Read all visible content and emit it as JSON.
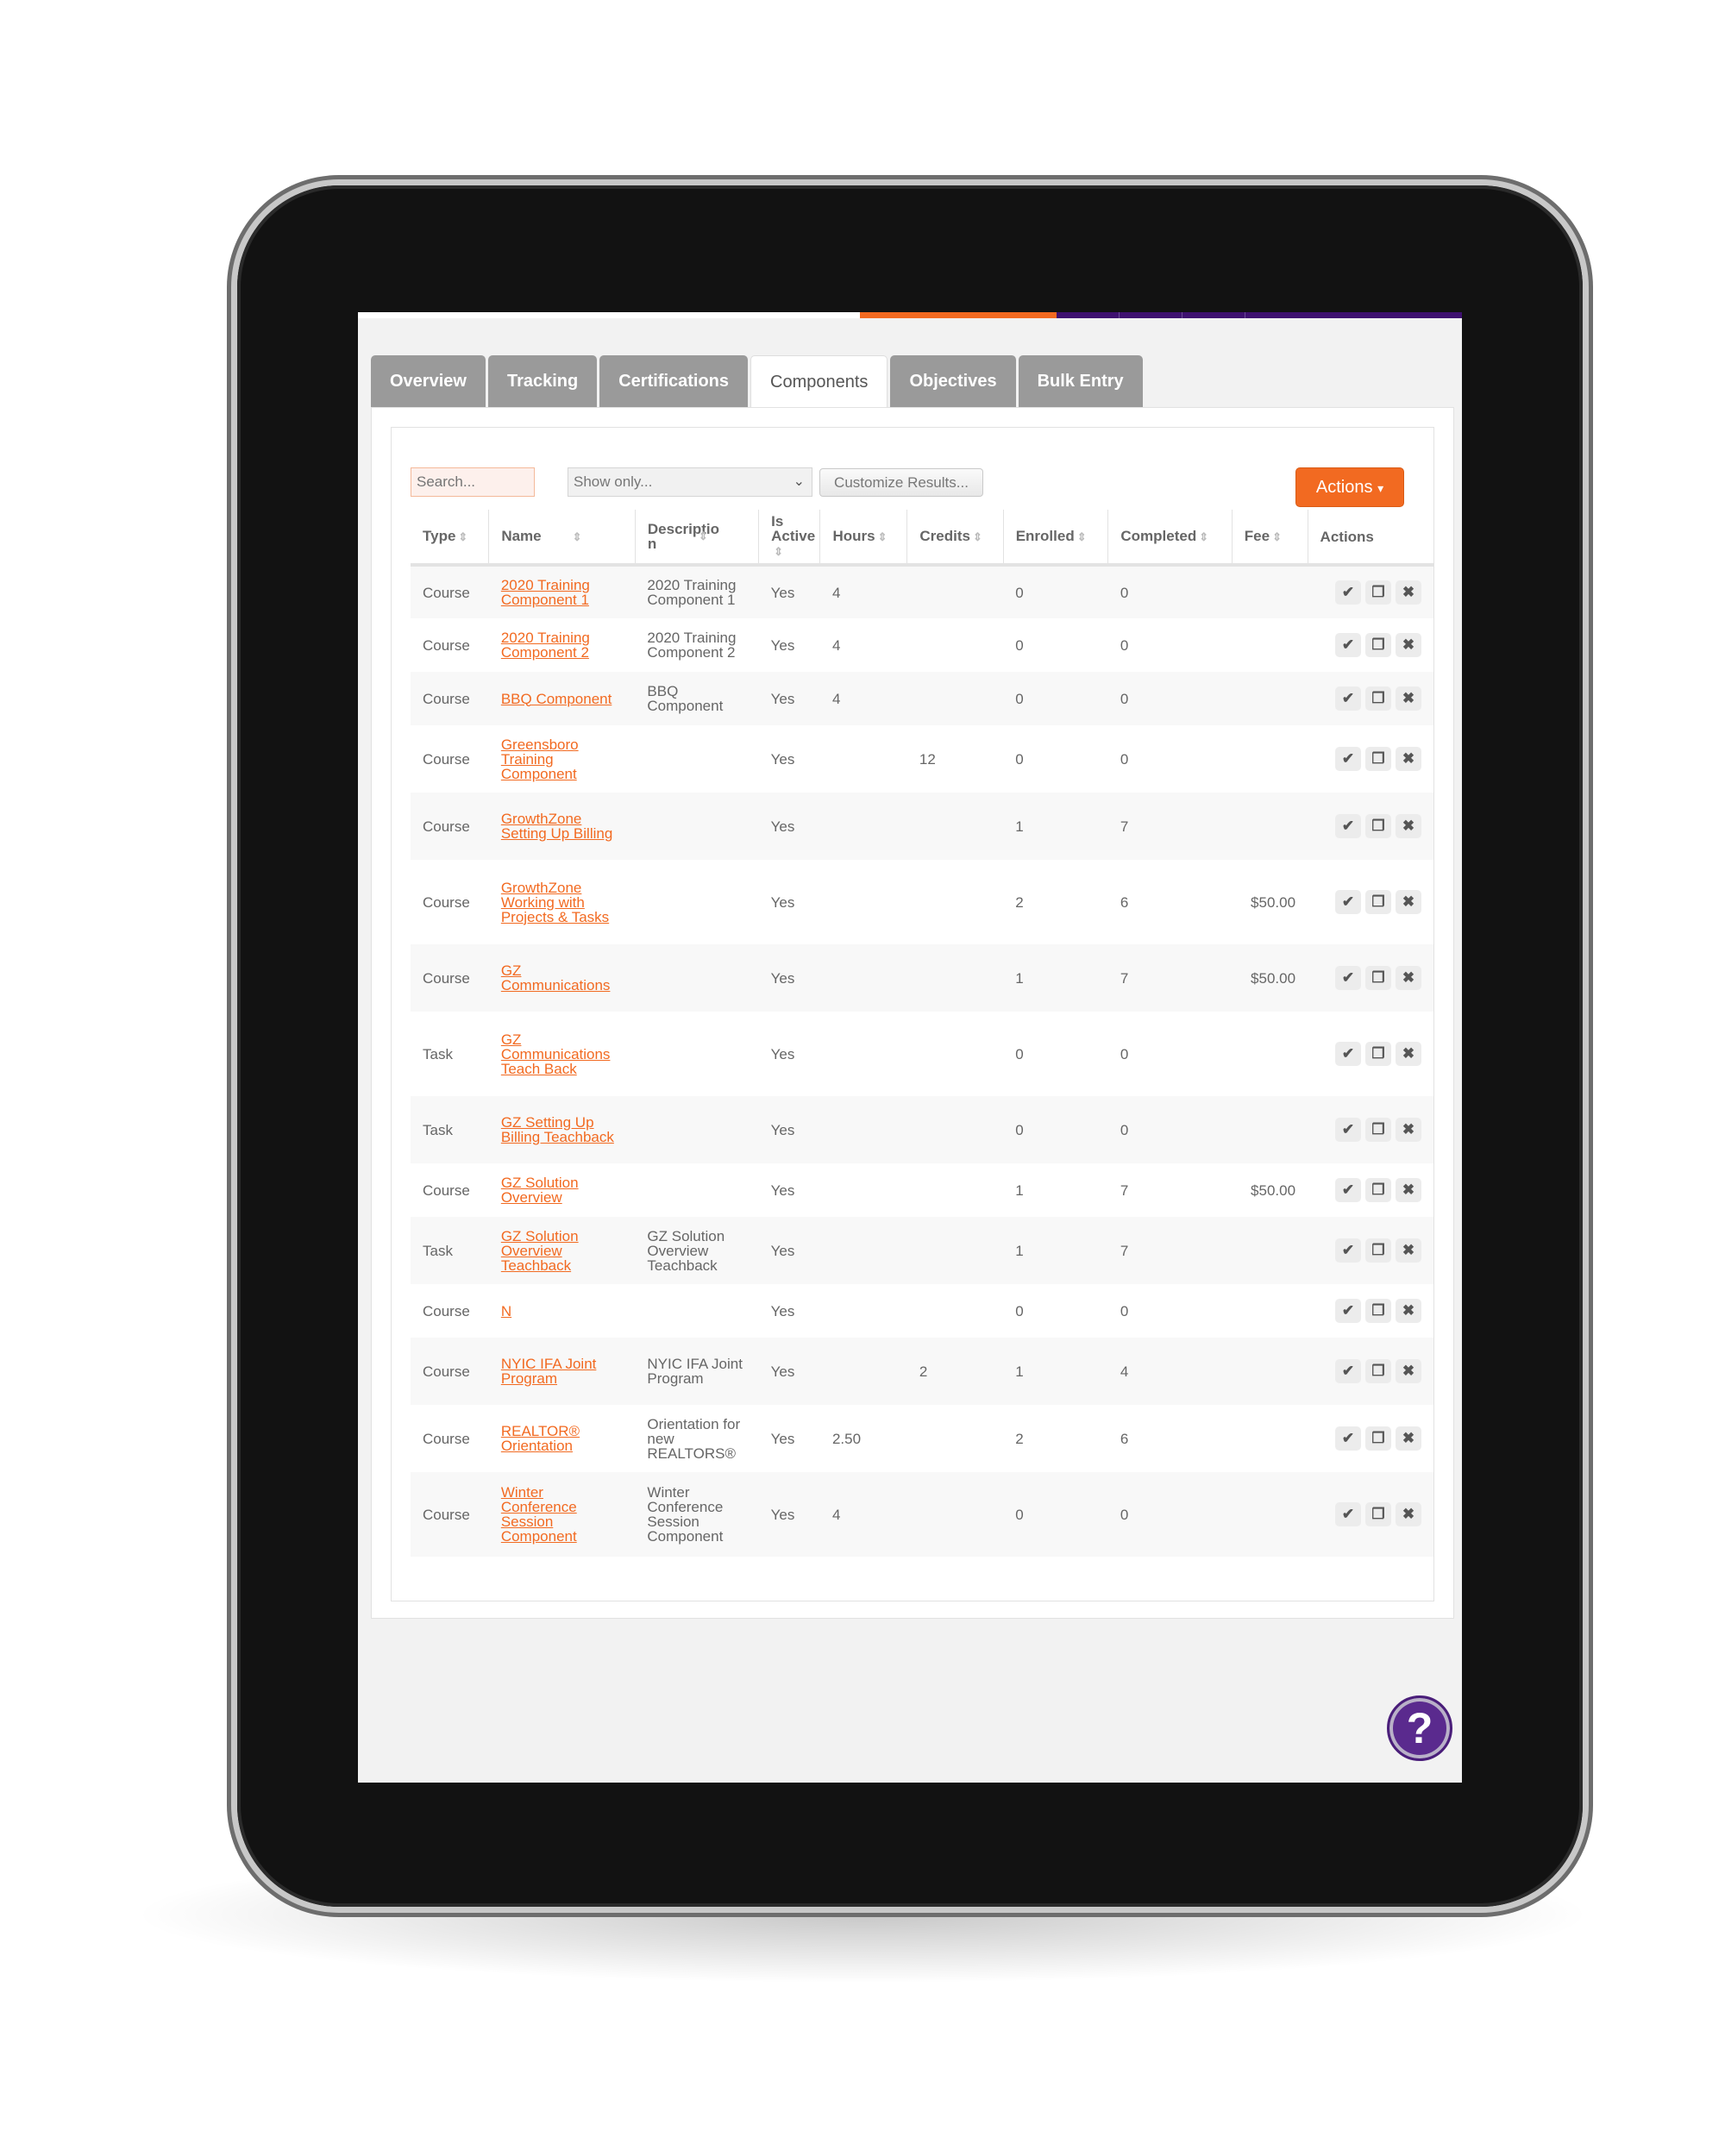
{
  "tabs": [
    {
      "label": "Overview",
      "active": false
    },
    {
      "label": "Tracking",
      "active": false
    },
    {
      "label": "Certifications",
      "active": false
    },
    {
      "label": "Components",
      "active": true
    },
    {
      "label": "Objectives",
      "active": false
    },
    {
      "label": "Bulk Entry",
      "active": false
    }
  ],
  "toolbar": {
    "search_placeholder": "Search...",
    "show_only": "Show only...",
    "customize_label": "Customize Results...",
    "actions_label": "Actions",
    "actions_caret": "▾"
  },
  "colors": {
    "accent_orange": "#f26a21",
    "brand_purple": "#3f1170"
  },
  "table": {
    "columns": [
      "Type",
      "Name",
      "Description",
      "Is Active",
      "Hours",
      "Credits",
      "Enrolled",
      "Completed",
      "Fee",
      "Actions"
    ],
    "column_labels_display": [
      "Type",
      "Name",
      "Descriptio n",
      "Is Active",
      "Hours",
      "Credits",
      "Enrolled",
      "Completed",
      "Fee",
      "Actions"
    ],
    "rows": [
      {
        "type": "Course",
        "name": "2020 Training Component 1",
        "description": "2020 Training Component 1",
        "is_active": "Yes",
        "hours": "4",
        "credits": "",
        "enrolled": "0",
        "completed": "0",
        "fee": ""
      },
      {
        "type": "Course",
        "name": "2020 Training Component 2",
        "description": "2020 Training Component 2",
        "is_active": "Yes",
        "hours": "4",
        "credits": "",
        "enrolled": "0",
        "completed": "0",
        "fee": ""
      },
      {
        "type": "Course",
        "name": "BBQ Component",
        "description": "BBQ Component",
        "is_active": "Yes",
        "hours": "4",
        "credits": "",
        "enrolled": "0",
        "completed": "0",
        "fee": ""
      },
      {
        "type": "Course",
        "name": "Greensboro Training Component",
        "description": "",
        "is_active": "Yes",
        "hours": "",
        "credits": "12",
        "enrolled": "0",
        "completed": "0",
        "fee": ""
      },
      {
        "type": "Course",
        "name": "GrowthZone Setting Up Billing",
        "description": "",
        "is_active": "Yes",
        "hours": "",
        "credits": "",
        "enrolled": "1",
        "completed": "7",
        "fee": ""
      },
      {
        "type": "Course",
        "name": "GrowthZone Working with Projects & Tasks",
        "description": "",
        "is_active": "Yes",
        "hours": "",
        "credits": "",
        "enrolled": "2",
        "completed": "6",
        "fee": "$50.00"
      },
      {
        "type": "Course",
        "name": "GZ Communications",
        "description": "",
        "is_active": "Yes",
        "hours": "",
        "credits": "",
        "enrolled": "1",
        "completed": "7",
        "fee": "$50.00"
      },
      {
        "type": "Task",
        "name": "GZ Communications Teach Back",
        "description": "",
        "is_active": "Yes",
        "hours": "",
        "credits": "",
        "enrolled": "0",
        "completed": "0",
        "fee": ""
      },
      {
        "type": "Task",
        "name": "GZ Setting Up Billing Teachback",
        "description": "",
        "is_active": "Yes",
        "hours": "",
        "credits": "",
        "enrolled": "0",
        "completed": "0",
        "fee": ""
      },
      {
        "type": "Course",
        "name": "GZ Solution Overview",
        "description": "",
        "is_active": "Yes",
        "hours": "",
        "credits": "",
        "enrolled": "1",
        "completed": "7",
        "fee": "$50.00"
      },
      {
        "type": "Task",
        "name": "GZ Solution Overview Teachback",
        "description": "GZ Solution Overview Teachback",
        "is_active": "Yes",
        "hours": "",
        "credits": "",
        "enrolled": "1",
        "completed": "7",
        "fee": ""
      },
      {
        "type": "Course",
        "name": "N",
        "description": "",
        "is_active": "Yes",
        "hours": "",
        "credits": "",
        "enrolled": "0",
        "completed": "0",
        "fee": ""
      },
      {
        "type": "Course",
        "name": "NYIC IFA Joint Program",
        "description": "NYIC IFA Joint Program",
        "is_active": "Yes",
        "hours": "",
        "credits": "2",
        "enrolled": "1",
        "completed": "4",
        "fee": ""
      },
      {
        "type": "Course",
        "name": "REALTOR® Orientation",
        "description": "Orientation for new REALTORS®",
        "is_active": "Yes",
        "hours": "2.50",
        "credits": "",
        "enrolled": "2",
        "completed": "6",
        "fee": ""
      },
      {
        "type": "Course",
        "name": "Winter Conference Session Component",
        "description": "Winter Conference Session Component",
        "is_active": "Yes",
        "hours": "4",
        "credits": "",
        "enrolled": "0",
        "completed": "0",
        "fee": ""
      }
    ],
    "row_actions": [
      {
        "icon": "check-icon",
        "glyph": "✔"
      },
      {
        "icon": "copy-icon",
        "glyph": "❐"
      },
      {
        "icon": "delete-icon",
        "glyph": "✖"
      }
    ]
  },
  "help_button": {
    "icon": "help-icon",
    "glyph": "?"
  }
}
